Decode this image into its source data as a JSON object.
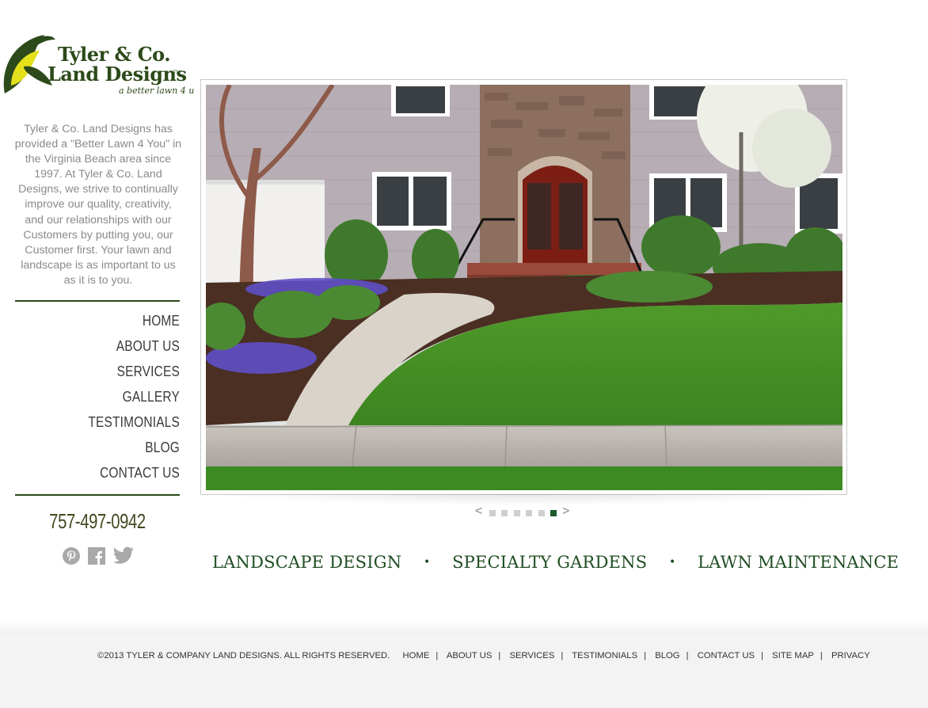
{
  "brand": {
    "line1": "Tyler & Co.",
    "line2": "Land Designs",
    "trademark": "TM",
    "tagline": "a better lawn 4 u",
    "colors": {
      "primary": "#2d4a1a",
      "accent": "#e4e11c",
      "active_dot": "#1d5a2c"
    }
  },
  "intro": "Tyler & Co. Land Designs has provided a \"Better Lawn 4 You\" in the Virginia Beach area since 1997. At Tyler & Co. Land Designs, we strive to continually improve our quality, creativity, and our relationships with our Customers by putting you, our Customer first. Your lawn and landscape is as important to us as it is to you.",
  "nav": [
    {
      "label": "HOME"
    },
    {
      "label": "ABOUT US"
    },
    {
      "label": "SERVICES"
    },
    {
      "label": "GALLERY"
    },
    {
      "label": "TESTIMONIALS"
    },
    {
      "label": "BLOG"
    },
    {
      "label": "CONTACT US"
    }
  ],
  "phone": "757-497-0942",
  "social": [
    {
      "icon": "pinterest-icon"
    },
    {
      "icon": "facebook-icon"
    },
    {
      "icon": "twitter-icon"
    }
  ],
  "hero": {
    "image": "landscape-photo-house-front-yard",
    "slider": {
      "prev": "<",
      "next": ">",
      "count": 6,
      "active_index": 5
    }
  },
  "services": [
    "LANDSCAPE DESIGN",
    "SPECIALTY GARDENS",
    "LAWN MAINTENANCE"
  ],
  "services_separator": "•",
  "footer": {
    "copyright": "©2013 TYLER & COMPANY LAND DESIGNS. ALL RIGHTS RESERVED.",
    "separator": "|",
    "links": [
      "HOME",
      "ABOUT US",
      "SERVICES",
      "TESTIMONIALS",
      "BLOG",
      "CONTACT US",
      "SITE MAP",
      "PRIVACY"
    ]
  }
}
